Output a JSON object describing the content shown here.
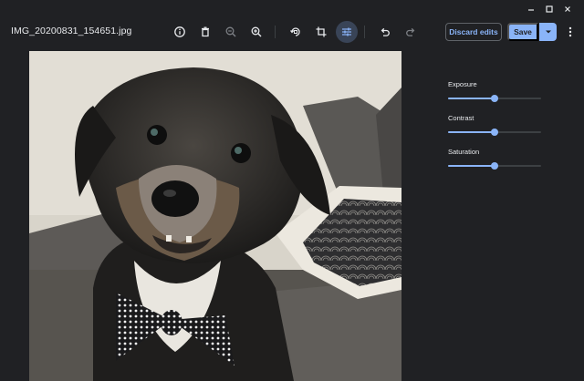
{
  "window_controls": {
    "icons": [
      "minimize-icon",
      "maximize-icon",
      "close-icon"
    ]
  },
  "toolbar": {
    "filename": "IMG_20200831_154651.jpg",
    "icons": [
      "info-icon",
      "delete-icon",
      "zoom-out-icon",
      "zoom-in-icon",
      "rotate-icon",
      "crop-icon",
      "tune-icon",
      "undo-icon",
      "redo-icon"
    ],
    "discard_label": "Discard edits",
    "save_label": "Save"
  },
  "adjust_panel": {
    "sliders": [
      {
        "label": "Exposure",
        "value": 0.5
      },
      {
        "label": "Contrast",
        "value": 0.5
      },
      {
        "label": "Saturation",
        "value": 0.5
      }
    ]
  },
  "colors": {
    "background": "#202124",
    "accent": "#8ab4f8",
    "text": "#e8eaed",
    "active_button": "#394457"
  }
}
